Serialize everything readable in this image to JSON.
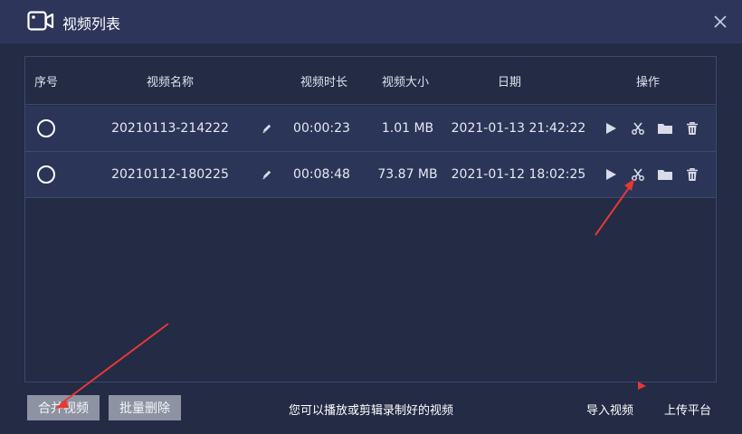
{
  "window": {
    "title": "视频列表"
  },
  "table": {
    "headers": [
      "序号",
      "视频名称",
      "视频时长",
      "视频大小",
      "日期",
      "操作"
    ],
    "rows": [
      {
        "name": "20210113-214222",
        "duration": "00:00:23",
        "size": "1.01 MB",
        "date": "2021-01-13 21:42:22"
      },
      {
        "name": "20210112-180225",
        "duration": "00:08:48",
        "size": "73.87 MB",
        "date": "2021-01-12 18:02:25"
      }
    ]
  },
  "footer": {
    "merge_label": "合并视频",
    "batch_delete_label": "批量删除",
    "hint": "您可以播放或剪辑录制好的视频",
    "import_label": "导入视频",
    "upload_label": "上传平台"
  },
  "colors": {
    "accent": "#2b3558",
    "annotation": "#e53935",
    "button": "#8d93a3"
  }
}
